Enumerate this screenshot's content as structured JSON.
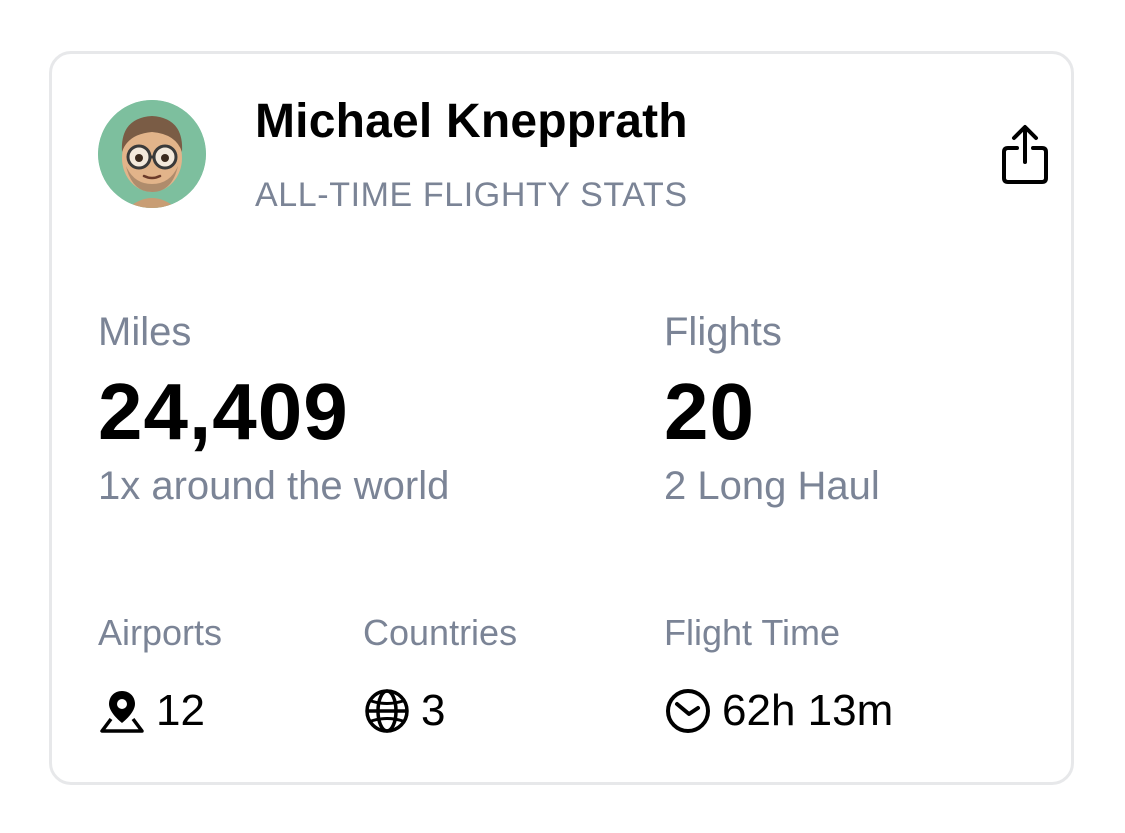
{
  "profile": {
    "name": "Michael Knepprath",
    "subtitle": "ALL-TIME FLIGHTY STATS",
    "avatar_color": "#7dbf9e"
  },
  "actions": {
    "share_icon": "share-icon"
  },
  "stats": {
    "miles": {
      "label": "Miles",
      "value": "24,409",
      "sub": "1x around the world"
    },
    "flights": {
      "label": "Flights",
      "value": "20",
      "sub": "2 Long Haul"
    },
    "airports": {
      "label": "Airports",
      "value": "12",
      "icon": "map-pin-icon"
    },
    "countries": {
      "label": "Countries",
      "value": "3",
      "icon": "globe-icon"
    },
    "flight_time": {
      "label": "Flight Time",
      "value": "62h 13m",
      "icon": "clock-icon"
    }
  },
  "colors": {
    "label_gray": "#7b8496",
    "card_border": "#e7e8ea"
  }
}
